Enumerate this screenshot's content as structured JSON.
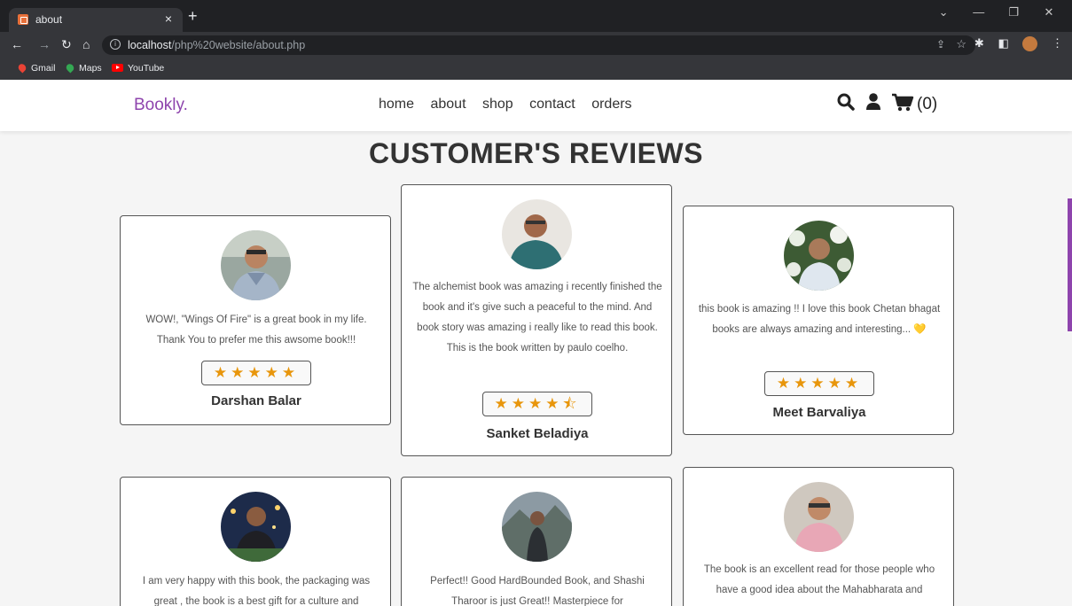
{
  "browser": {
    "tab_title": "about",
    "tab_close": "×",
    "new_tab": "+",
    "url_host": "localhost",
    "url_path": "/php%20website/about.php",
    "bookmarks": [
      {
        "label": "Gmail",
        "icon": "gmail-pin-icon",
        "color": "#ea4335"
      },
      {
        "label": "Maps",
        "icon": "maps-pin-icon",
        "color": "#34a853"
      },
      {
        "label": "YouTube",
        "icon": "youtube-icon",
        "color": "#ff0000"
      }
    ]
  },
  "site": {
    "logo": "Bookly.",
    "nav": [
      "home",
      "about",
      "shop",
      "contact",
      "orders"
    ],
    "cart_count": "(0)",
    "accent_color": "#8e44ad",
    "star_color": "#e8960c"
  },
  "reviews": {
    "title": "CUSTOMER'S REVIEWS",
    "items": [
      {
        "text": "WOW!, \"Wings Of Fire\" is a great book in my life. Thank You to prefer me this awsome book!!!",
        "rating": 5,
        "stars": "★★★★★",
        "name": "Darshan Balar"
      },
      {
        "text": "The alchemist book was amazing i recently finished the book and it's give such a peaceful to the mind. And book story was amazing i really like to read this book. This is the book written by paulo coelho.",
        "rating": 4.5,
        "stars": "★★★★⯪",
        "name": "Sanket Beladiya"
      },
      {
        "text": "this book is amazing !! I love this book Chetan bhagat books are always amazing and interesting... 💛",
        "rating": 5,
        "stars": "★★★★★",
        "name": "Meet Barvaliya"
      },
      {
        "text": "I am very happy with this book, the packaging was great , the book is a best gift for a culture and",
        "name": ""
      },
      {
        "text": "Perfect!! Good HardBounded Book, and Shashi Tharoor is just Great!! Masterpiece for",
        "name": ""
      },
      {
        "text": "The book is an excellent read for those people who have a good idea about the Mahabharata and",
        "name": ""
      }
    ]
  }
}
